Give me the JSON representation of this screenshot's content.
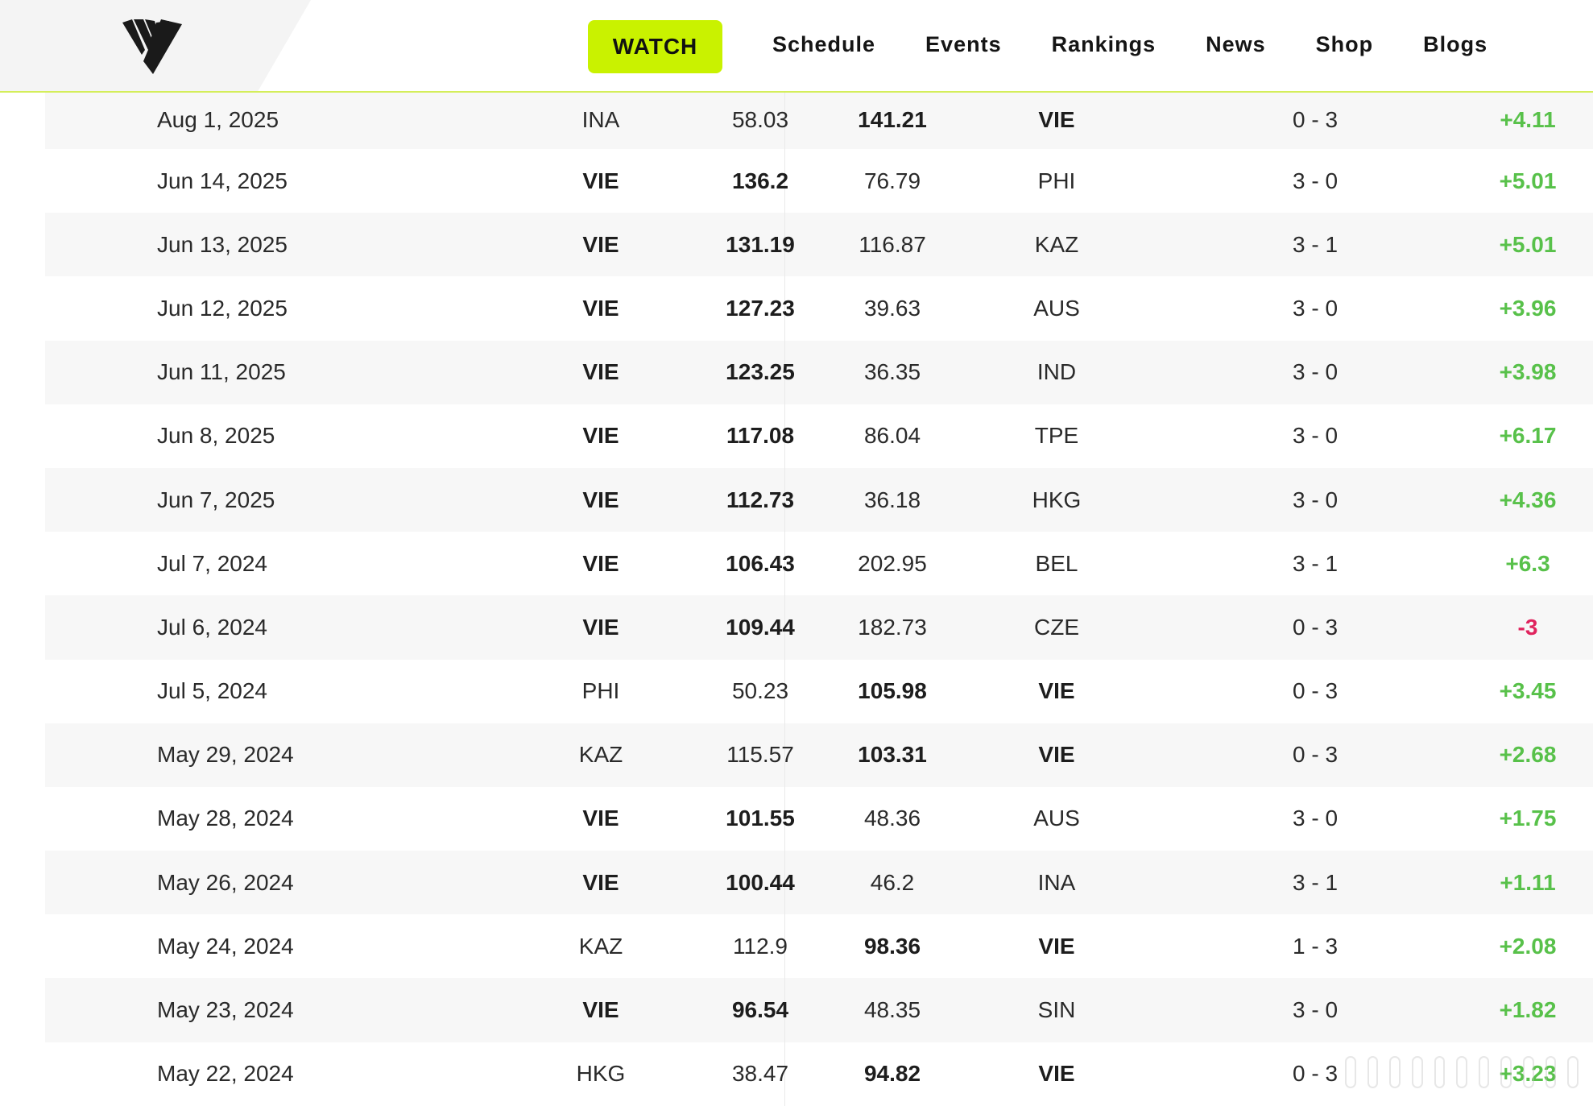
{
  "nav": {
    "watch": "WATCH",
    "links": [
      "Schedule",
      "Events",
      "Rankings",
      "News",
      "Shop",
      "Blogs"
    ]
  },
  "brand": {
    "accent": "#c9f200",
    "positive": "#58c14a",
    "negative": "#e0245e"
  },
  "rows": [
    {
      "date": "Aug 1, 2025",
      "team1": "INA",
      "rank1": "58.03",
      "rank2": "141.21",
      "team2": "VIE",
      "score": "0 - 3",
      "delta": "+4.11",
      "winner": 2
    },
    {
      "date": "Jun 14, 2025",
      "team1": "VIE",
      "rank1": "136.2",
      "rank2": "76.79",
      "team2": "PHI",
      "score": "3 - 0",
      "delta": "+5.01",
      "winner": 1
    },
    {
      "date": "Jun 13, 2025",
      "team1": "VIE",
      "rank1": "131.19",
      "rank2": "116.87",
      "team2": "KAZ",
      "score": "3 - 1",
      "delta": "+5.01",
      "winner": 1
    },
    {
      "date": "Jun 12, 2025",
      "team1": "VIE",
      "rank1": "127.23",
      "rank2": "39.63",
      "team2": "AUS",
      "score": "3 - 0",
      "delta": "+3.96",
      "winner": 1
    },
    {
      "date": "Jun 11, 2025",
      "team1": "VIE",
      "rank1": "123.25",
      "rank2": "36.35",
      "team2": "IND",
      "score": "3 - 0",
      "delta": "+3.98",
      "winner": 1
    },
    {
      "date": "Jun 8, 2025",
      "team1": "VIE",
      "rank1": "117.08",
      "rank2": "86.04",
      "team2": "TPE",
      "score": "3 - 0",
      "delta": "+6.17",
      "winner": 1
    },
    {
      "date": "Jun 7, 2025",
      "team1": "VIE",
      "rank1": "112.73",
      "rank2": "36.18",
      "team2": "HKG",
      "score": "3 - 0",
      "delta": "+4.36",
      "winner": 1
    },
    {
      "date": "Jul 7, 2024",
      "team1": "VIE",
      "rank1": "106.43",
      "rank2": "202.95",
      "team2": "BEL",
      "score": "3 - 1",
      "delta": "+6.3",
      "winner": 1
    },
    {
      "date": "Jul 6, 2024",
      "team1": "VIE",
      "rank1": "109.44",
      "rank2": "182.73",
      "team2": "CZE",
      "score": "0 - 3",
      "delta": "-3",
      "winner": 1
    },
    {
      "date": "Jul 5, 2024",
      "team1": "PHI",
      "rank1": "50.23",
      "rank2": "105.98",
      "team2": "VIE",
      "score": "0 - 3",
      "delta": "+3.45",
      "winner": 2
    },
    {
      "date": "May 29, 2024",
      "team1": "KAZ",
      "rank1": "115.57",
      "rank2": "103.31",
      "team2": "VIE",
      "score": "0 - 3",
      "delta": "+2.68",
      "winner": 2
    },
    {
      "date": "May 28, 2024",
      "team1": "VIE",
      "rank1": "101.55",
      "rank2": "48.36",
      "team2": "AUS",
      "score": "3 - 0",
      "delta": "+1.75",
      "winner": 1
    },
    {
      "date": "May 26, 2024",
      "team1": "VIE",
      "rank1": "100.44",
      "rank2": "46.2",
      "team2": "INA",
      "score": "3 - 1",
      "delta": "+1.11",
      "winner": 1
    },
    {
      "date": "May 24, 2024",
      "team1": "KAZ",
      "rank1": "112.9",
      "rank2": "98.36",
      "team2": "VIE",
      "score": "1 - 3",
      "delta": "+2.08",
      "winner": 2
    },
    {
      "date": "May 23, 2024",
      "team1": "VIE",
      "rank1": "96.54",
      "rank2": "48.35",
      "team2": "SIN",
      "score": "3 - 0",
      "delta": "+1.82",
      "winner": 1
    },
    {
      "date": "May 22, 2024",
      "team1": "HKG",
      "rank1": "38.47",
      "rank2": "94.82",
      "team2": "VIE",
      "score": "0 - 3",
      "delta": "+3.23",
      "winner": 2
    }
  ]
}
